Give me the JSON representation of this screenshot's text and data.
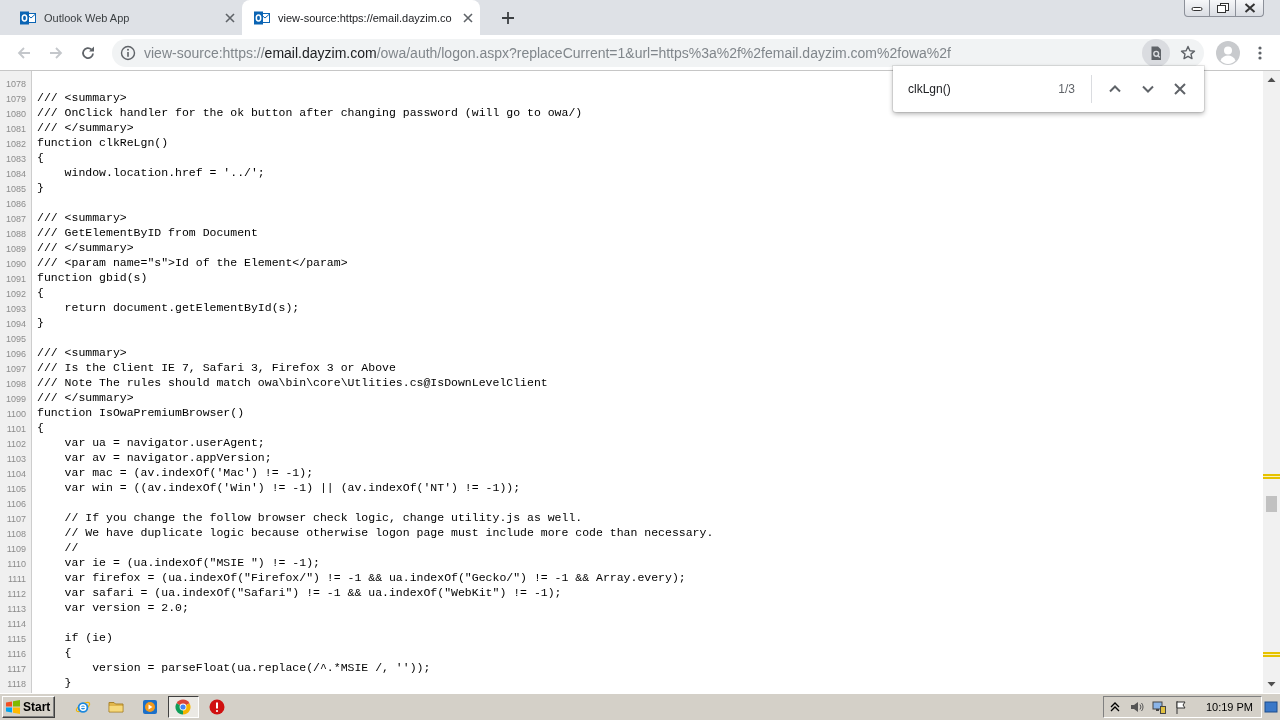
{
  "browser": {
    "tabs": [
      {
        "title": "Outlook Web App",
        "selected": false
      },
      {
        "title": "view-source:https://email.dayzim.co",
        "selected": true
      }
    ],
    "toolbar": {
      "back": {
        "disabled": true
      },
      "forward": {
        "disabled": true
      },
      "url": {
        "scheme": "view-source:https://",
        "host": "email.dayzim.com",
        "path": "/owa/auth/logon.aspx?replaceCurrent=1&url=https%3a%2f%2femail.dayzim.com%2fowa%2f"
      }
    },
    "find_bar": {
      "query": "clkLgn()",
      "match_count": "1/3"
    }
  },
  "source_view": {
    "lines": [
      {
        "number": "1078"
      },
      {
        "number": "1079",
        "code": "/// <summary>"
      },
      {
        "number": "1080",
        "code": "/// OnClick handler for the ok button after changing password (will go to owa/)"
      },
      {
        "number": "1081",
        "code": "/// </summary>"
      },
      {
        "number": "1082",
        "code": "function clkReLgn()"
      },
      {
        "number": "1083",
        "code": "{"
      },
      {
        "number": "1084",
        "code": "    window.location.href = '../';"
      },
      {
        "number": "1085",
        "code": "}"
      },
      {
        "number": "1086"
      },
      {
        "number": "1087",
        "code": "/// <summary>"
      },
      {
        "number": "1088",
        "code": "/// GetElementByID from Document"
      },
      {
        "number": "1089",
        "code": "/// </summary>"
      },
      {
        "number": "1090",
        "code": "/// <param name=\"s\">Id of the Element</param>"
      },
      {
        "number": "1091",
        "code": "function gbid(s)"
      },
      {
        "number": "1092",
        "code": "{"
      },
      {
        "number": "1093",
        "code": "    return document.getElementById(s);"
      },
      {
        "number": "1094",
        "code": "}"
      },
      {
        "number": "1095"
      },
      {
        "number": "1096",
        "code": "/// <summary>"
      },
      {
        "number": "1097",
        "code": "/// Is the Client IE 7, Safari 3, Firefox 3 or Above"
      },
      {
        "number": "1098",
        "code": "/// Note The rules should match owa\\bin\\core\\Utlities.cs@IsDownLevelClient"
      },
      {
        "number": "1099",
        "code": "/// </summary>"
      },
      {
        "number": "1100",
        "code": "function IsOwaPremiumBrowser()"
      },
      {
        "number": "1101",
        "code": "{"
      },
      {
        "number": "1102",
        "code": "    var ua = navigator.userAgent;"
      },
      {
        "number": "1103",
        "code": "    var av = navigator.appVersion;"
      },
      {
        "number": "1104",
        "code": "    var mac = (av.indexOf('Mac') != -1);"
      },
      {
        "number": "1105",
        "code": "    var win = ((av.indexOf('Win') != -1) || (av.indexOf('NT') != -1));"
      },
      {
        "number": "1106"
      },
      {
        "number": "1107",
        "code": "    // If you change the follow browser check logic, change utility.js as well."
      },
      {
        "number": "1108",
        "code": "    // We have duplicate logic because otherwise logon page must include more code than necessary."
      },
      {
        "number": "1109",
        "code": "    //"
      },
      {
        "number": "1110",
        "code": "    var ie = (ua.indexOf(\"MSIE \") != -1);"
      },
      {
        "number": "1111",
        "code": "    var firefox = (ua.indexOf(\"Firefox/\") != -1 && ua.indexOf(\"Gecko/\") != -1 && Array.every);"
      },
      {
        "number": "1112",
        "code": "    var safari = (ua.indexOf(\"Safari\") != -1 && ua.indexOf(\"WebKit\") != -1);"
      },
      {
        "number": "1113",
        "code": "    var version = 2.0;"
      },
      {
        "number": "1114"
      },
      {
        "number": "1115",
        "code": "    if (ie)"
      },
      {
        "number": "1116",
        "code": "    {"
      },
      {
        "number": "1117",
        "code": "        version = parseFloat(ua.replace(/^.*MSIE /, ''));"
      },
      {
        "number": "1118",
        "code": "    }"
      }
    ]
  },
  "taskbar": {
    "start_label": "Start",
    "apps": [
      {
        "kind": "ie",
        "active": false
      },
      {
        "kind": "folder",
        "active": false
      },
      {
        "kind": "media",
        "active": false
      },
      {
        "kind": "chrome",
        "active": true
      },
      {
        "kind": "alert",
        "active": false
      }
    ],
    "clock": "10:19 PM"
  }
}
